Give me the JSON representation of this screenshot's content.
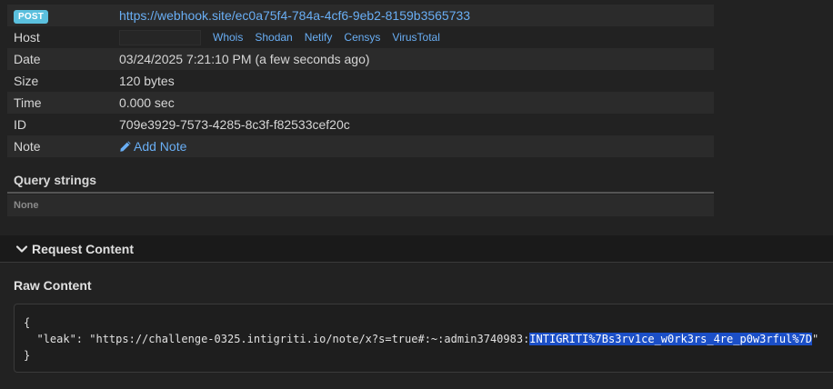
{
  "request": {
    "method": "POST",
    "url": "https://webhook.site/ec0a75f4-784a-4cf6-9eb2-8159b3565733",
    "host_label": "Host",
    "host_links": [
      "Whois",
      "Shodan",
      "Netify",
      "Censys",
      "VirusTotal"
    ],
    "date_label": "Date",
    "date_value": "03/24/2025 7:21:10 PM (a few seconds ago)",
    "size_label": "Size",
    "size_value": "120 bytes",
    "time_label": "Time",
    "time_value": "0.000 sec",
    "id_label": "ID",
    "id_value": "709e3929-7573-4285-8c3f-f82533cef20c",
    "note_label": "Note",
    "add_note": "Add Note"
  },
  "query_strings": {
    "title": "Query strings",
    "value": "None"
  },
  "request_content": {
    "title": "Request Content",
    "raw_title": "Raw Content",
    "line1": "{",
    "line2_prefix": "  \"leak\": \"https://challenge-0325.intigriti.io/note/x?s=true#:~:admin3740983:",
    "line2_highlight": "INTIGRITI%7Bs3rv1ce_w0rk3rs_4re_p0w3rful%7D",
    "line2_suffix": "\"",
    "line3": "}"
  },
  "colors": {
    "badge": "#5bc0de",
    "link": "#69aef4",
    "highlight": "#1b4fc7"
  }
}
